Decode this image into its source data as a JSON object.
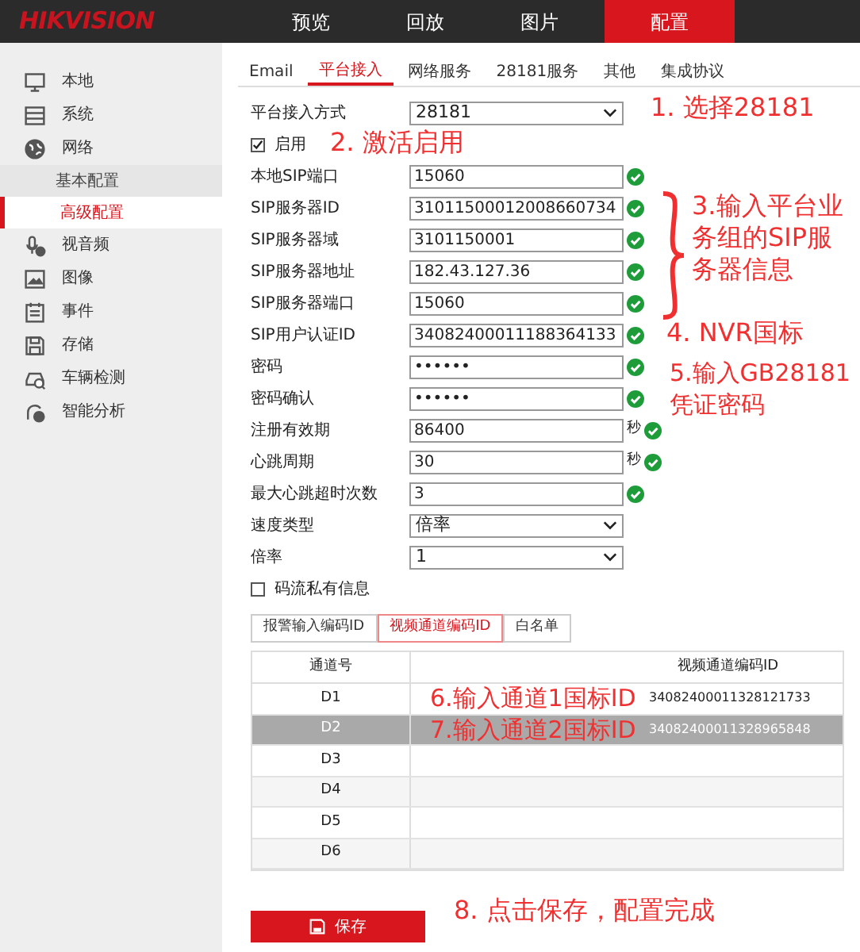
{
  "header": {
    "logo": "HIKVISION",
    "nav": [
      {
        "label": "预览",
        "selected": false
      },
      {
        "label": "回放",
        "selected": false
      },
      {
        "label": "图片",
        "selected": false
      },
      {
        "label": "配置",
        "selected": true
      }
    ]
  },
  "sidebar": {
    "items": [
      {
        "label": "本地",
        "selected": false
      },
      {
        "label": "系统",
        "selected": false
      },
      {
        "label": "网络",
        "selected": false,
        "children": [
          {
            "label": "基本配置",
            "selected": false
          },
          {
            "label": "高级配置",
            "selected": true
          }
        ]
      },
      {
        "label": "视音频",
        "selected": false
      },
      {
        "label": "图像",
        "selected": false
      },
      {
        "label": "事件",
        "selected": false
      },
      {
        "label": "存储",
        "selected": false
      },
      {
        "label": "车辆检测",
        "selected": false
      },
      {
        "label": "智能分析",
        "selected": false
      }
    ]
  },
  "tabs": [
    {
      "label": "Email",
      "selected": false
    },
    {
      "label": "平台接入",
      "selected": true
    },
    {
      "label": "网络服务",
      "selected": false
    },
    {
      "label": "28181服务",
      "selected": false
    },
    {
      "label": "其他",
      "selected": false
    },
    {
      "label": "集成协议",
      "selected": false
    }
  ],
  "form": [
    {
      "kind": "select",
      "label": "平台接入方式",
      "value": "28181"
    },
    {
      "kind": "checkbox",
      "label": "启用",
      "checked": true
    },
    {
      "kind": "input",
      "label": "本地SIP端口",
      "value": "15060",
      "valid": true
    },
    {
      "kind": "input",
      "label": "SIP服务器ID",
      "value": "31011500012008660734",
      "valid": true
    },
    {
      "kind": "input",
      "label": "SIP服务器域",
      "value": "3101150001",
      "valid": true
    },
    {
      "kind": "input",
      "label": "SIP服务器地址",
      "value": "182.43.127.36",
      "valid": true
    },
    {
      "kind": "input",
      "label": "SIP服务器端口",
      "value": "15060",
      "valid": true
    },
    {
      "kind": "input",
      "label": "SIP用户认证ID",
      "value": "34082400011188364133",
      "valid": true
    },
    {
      "kind": "input",
      "label": "密码",
      "value": "••••••",
      "valid": true
    },
    {
      "kind": "input",
      "label": "密码确认",
      "value": "••••••",
      "valid": true
    },
    {
      "kind": "input",
      "label": "注册有效期",
      "value": "86400",
      "unit": "秒",
      "valid": true
    },
    {
      "kind": "input",
      "label": "心跳周期",
      "value": "30",
      "unit": "秒",
      "valid": true
    },
    {
      "kind": "input",
      "label": "最大心跳超时次数",
      "value": "3",
      "valid": true
    },
    {
      "kind": "select",
      "label": "速度类型",
      "value": "倍率"
    },
    {
      "kind": "select",
      "label": "倍率",
      "value": "1"
    },
    {
      "kind": "checkbox",
      "label": "码流私有信息",
      "checked": false
    }
  ],
  "subtabs": [
    {
      "label": "报警输入编码ID",
      "selected": false
    },
    {
      "label": "视频通道编码ID",
      "selected": true
    },
    {
      "label": "白名单",
      "selected": false
    }
  ],
  "table": {
    "columns": [
      "通道号",
      "视频通道编码ID"
    ],
    "rows": [
      {
        "channel": "D1",
        "annotation": "6.输入通道1国标ID",
        "id": "34082400011328121733",
        "selected": false
      },
      {
        "channel": "D2",
        "annotation": "7.输入通道2国标ID",
        "id": "34082400011328965848",
        "selected": true
      },
      {
        "channel": "D3",
        "selected": false
      },
      {
        "channel": "D4",
        "selected": false
      },
      {
        "channel": "D5",
        "selected": false
      },
      {
        "channel": "D6",
        "selected": false
      }
    ]
  },
  "save_button": "保存",
  "annotations": [
    "1. 选择28181",
    "2. 激活启用",
    "3.输入平台业务组的SIP服务器信息",
    "4. NVR国标",
    "5.输入GB28181凭证密码",
    "8. 点击保存，配置完成"
  ]
}
